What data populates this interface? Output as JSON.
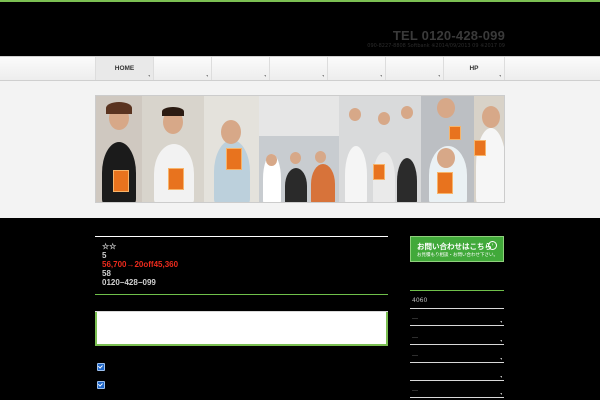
{
  "header": {
    "tel": "TEL 0120-428-099",
    "subinfo": "090-8227-8808 Softbank ※2014/09/2013 09 ※2017 09"
  },
  "nav": {
    "items": [
      {
        "label": "HOME"
      },
      {
        "label": ""
      },
      {
        "label": ""
      },
      {
        "label": ""
      },
      {
        "label": ""
      },
      {
        "label": ""
      },
      {
        "label": ""
      },
      {
        "label": "HP"
      }
    ]
  },
  "main": {
    "stars": "☆☆",
    "line2": "5",
    "price": "56,700→20off45,360",
    "line4": "58",
    "phone": "0120−428−099"
  },
  "sidebar": {
    "contact_title": "お問い合わせはこちら",
    "contact_sub": "お見積もり相談・お問い合わせ下さい。",
    "items": [
      {
        "label": "4060"
      },
      {
        "label": "…"
      },
      {
        "label": "…"
      },
      {
        "label": "…"
      },
      {
        "label": ""
      },
      {
        "label": "…"
      }
    ]
  },
  "colors": {
    "accent_green": "#6fbf4a",
    "price_red": "#ee2b1d",
    "button_green": "#41a93a"
  }
}
